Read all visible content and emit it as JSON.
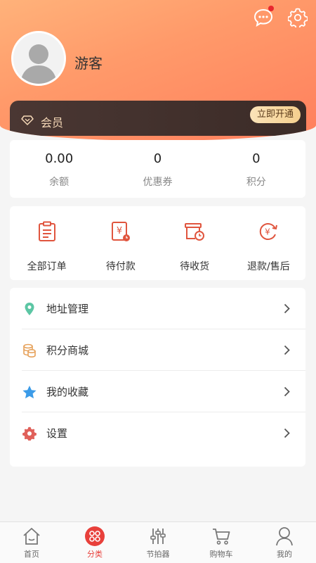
{
  "header": {
    "username": "游客",
    "icons": [
      "message-icon",
      "settings-icon"
    ],
    "has_unread": true
  },
  "member": {
    "label": "会员",
    "button": "立即开通"
  },
  "stats": [
    {
      "value": "0.00",
      "label": "余额"
    },
    {
      "value": "0",
      "label": "优惠券"
    },
    {
      "value": "0",
      "label": "积分"
    }
  ],
  "orders": [
    {
      "label": "全部订单",
      "icon": "clipboard-icon"
    },
    {
      "label": "待付款",
      "icon": "pending-payment-icon"
    },
    {
      "label": "待收货",
      "icon": "pending-delivery-icon"
    },
    {
      "label": "退款/售后",
      "icon": "refund-icon"
    }
  ],
  "menu": [
    {
      "label": "地址管理",
      "icon": "location-pin-icon",
      "color": "#5cc6a4"
    },
    {
      "label": "积分商城",
      "icon": "coins-icon",
      "color": "#e6a15a"
    },
    {
      "label": "我的收藏",
      "icon": "star-icon",
      "color": "#3b9be8"
    },
    {
      "label": "设置",
      "icon": "gear-icon",
      "color": "#e0605a"
    }
  ],
  "tabbar": [
    {
      "label": "首页",
      "icon": "home-icon"
    },
    {
      "label": "分类",
      "icon": "category-icon",
      "active": true
    },
    {
      "label": "节拍器",
      "icon": "metronome-sliders-icon"
    },
    {
      "label": "购物车",
      "icon": "cart-icon"
    },
    {
      "label": "我的",
      "icon": "user-icon"
    }
  ],
  "colors": {
    "header_gradient_start": "#ffb27a",
    "header_gradient_end": "#ff7f5d",
    "member_bg": "#3b2b27",
    "accent_red": "#e8403b",
    "order_icon": "#e0553e"
  }
}
